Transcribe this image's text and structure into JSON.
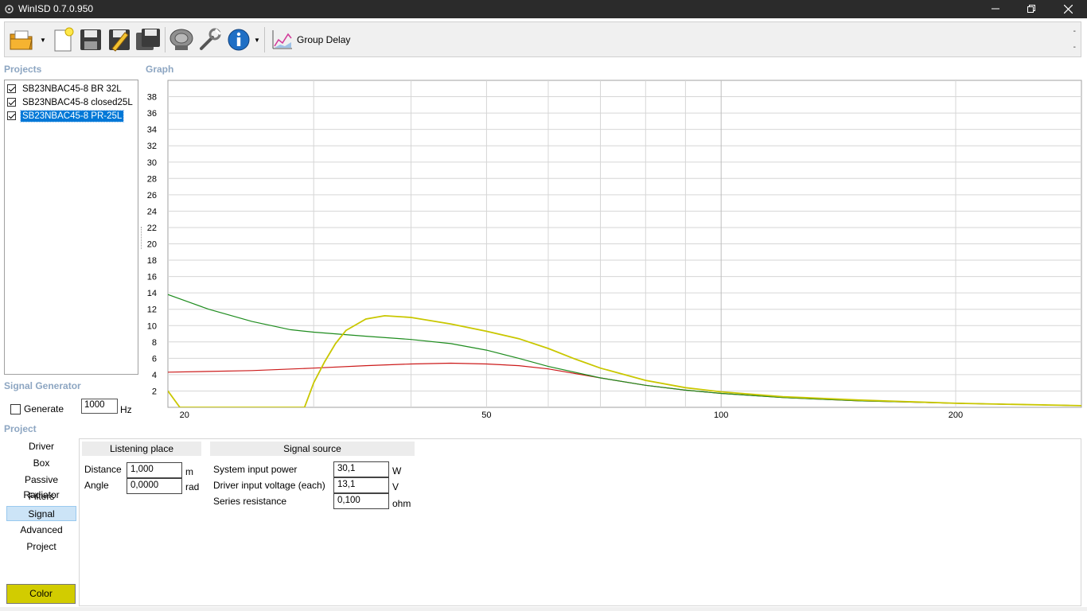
{
  "window": {
    "title": "WinISD 0.7.0.950"
  },
  "toolbar": {
    "icons": [
      "open-folder-icon",
      "new-file-icon",
      "save-icon",
      "edit-icon",
      "save-all-icon",
      "driver-speaker-icon",
      "tools-wrench-icon",
      "info-icon",
      "group-delay-graph-icon"
    ],
    "graph_label": "Group Delay",
    "dash_top": "-",
    "dash_bottom": "-"
  },
  "projects": {
    "heading": "Projects",
    "items": [
      {
        "label": "SB23NBAC45-8 BR 32L",
        "checked": true,
        "selected": false
      },
      {
        "label": "SB23NBAC45-8 closed25L",
        "checked": true,
        "selected": false
      },
      {
        "label": "SB23NBAC45-8 PR-25L",
        "checked": true,
        "selected": true
      }
    ]
  },
  "graph": {
    "heading": "Graph"
  },
  "signal_generator": {
    "heading": "Signal Generator",
    "generate_label": "Generate",
    "generate_checked": false,
    "frequency": "1000",
    "unit": "Hz"
  },
  "project_nav": {
    "heading": "Project",
    "items": [
      "Driver",
      "Box",
      "Passive Radiator",
      "Filters",
      "Signal",
      "Advanced",
      "Project"
    ],
    "selected": "Signal",
    "color_button": "Color",
    "color_value": "#d2cc00"
  },
  "listening_place": {
    "heading": "Listening place",
    "distance_label": "Distance",
    "distance_value": "1,000",
    "distance_unit": "m",
    "angle_label": "Angle",
    "angle_value": "0,0000",
    "angle_unit": "rad"
  },
  "signal_source": {
    "heading": "Signal source",
    "power_label": "System input power",
    "power_value": "30,1",
    "power_unit": "W",
    "voltage_label": "Driver input voltage (each)",
    "voltage_value": "13,1",
    "voltage_unit": "V",
    "resistance_label": "Series resistance",
    "resistance_value": "0,100",
    "resistance_unit": "ohm"
  },
  "chart_data": {
    "type": "line",
    "title": "",
    "xlabel": "",
    "ylabel": "",
    "xscale": "log",
    "xlim": [
      19.5,
      290
    ],
    "ylim": [
      0,
      40
    ],
    "x_ticks": [
      "20",
      "50",
      "100",
      "200"
    ],
    "y_ticks": [
      "2",
      "4",
      "6",
      "8",
      "10",
      "12",
      "14",
      "16",
      "18",
      "20",
      "22",
      "24",
      "26",
      "28",
      "30",
      "32",
      "34",
      "36",
      "38"
    ],
    "grid": true,
    "series": [
      {
        "color": "#cc1a1a",
        "x": [
          19.5,
          25,
          30,
          35,
          40,
          45,
          50,
          55,
          60,
          70,
          80,
          90,
          100,
          120,
          150,
          200,
          290
        ],
        "y": [
          4.3,
          4.5,
          4.8,
          5.1,
          5.3,
          5.4,
          5.3,
          5.1,
          4.7,
          3.6,
          2.7,
          2.1,
          1.7,
          1.2,
          0.8,
          0.5,
          0.2
        ]
      },
      {
        "color": "#1e8c1e",
        "x": [
          19.5,
          22,
          25,
          28,
          30,
          35,
          40,
          45,
          50,
          55,
          60,
          70,
          80,
          90,
          100,
          120,
          150,
          200,
          290
        ],
        "y": [
          13.8,
          12,
          10.5,
          9.5,
          9.2,
          8.7,
          8.3,
          7.8,
          7.0,
          6.0,
          5.0,
          3.6,
          2.7,
          2.1,
          1.7,
          1.2,
          0.8,
          0.5,
          0.2
        ]
      },
      {
        "color": "#c9c700",
        "x": [
          19.5,
          20.2,
          29.2,
          30,
          31,
          32,
          33,
          35,
          37,
          40,
          45,
          50,
          55,
          60,
          65,
          70,
          80,
          90,
          100,
          120,
          150,
          200,
          290
        ],
        "y": [
          2.0,
          0.0,
          0.0,
          3.0,
          5.6,
          7.8,
          9.4,
          10.8,
          11.2,
          11.0,
          10.2,
          9.3,
          8.4,
          7.2,
          5.9,
          4.8,
          3.3,
          2.4,
          1.9,
          1.3,
          0.9,
          0.5,
          0.2
        ]
      }
    ]
  }
}
